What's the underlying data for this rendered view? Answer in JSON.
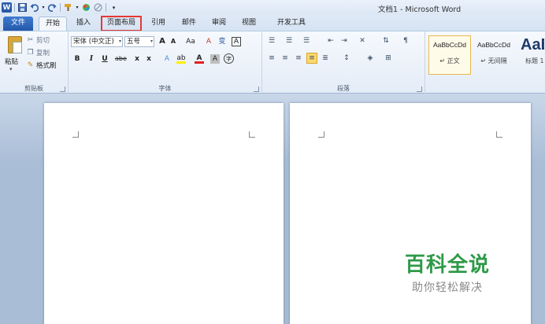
{
  "window": {
    "title": "文档1 - Microsoft Word"
  },
  "qat": {
    "icons": [
      "word-app-icon",
      "save-icon",
      "undo-icon",
      "redo-icon",
      "format-painter-icon",
      "color-icon",
      "edit-icon",
      "customize-icon"
    ],
    "word_letter": "W"
  },
  "tabs": [
    {
      "label": "文件"
    },
    {
      "label": "开始"
    },
    {
      "label": "插入"
    },
    {
      "label": "页面布局"
    },
    {
      "label": "引用"
    },
    {
      "label": "邮件"
    },
    {
      "label": "审阅"
    },
    {
      "label": "视图"
    },
    {
      "label": "开发工具"
    }
  ],
  "clipboard": {
    "paste": "粘贴",
    "cut": "剪切",
    "copy": "复制",
    "format_painter": "格式刷",
    "group_label": "剪贴板"
  },
  "font": {
    "font_name": "宋体 (中文正)",
    "font_size": "五号",
    "grow": "A",
    "shrink": "A",
    "change_case": "Aa",
    "clear_format": "A",
    "phonetic": "变",
    "border_char": "A",
    "bold": "B",
    "italic": "I",
    "underline": "U",
    "strike": "abe",
    "subscript": "x",
    "superscript": "x",
    "text_effect": "A",
    "highlight": "ab",
    "font_color": "A",
    "char_shading": "A",
    "enclose": "字",
    "group_label": "字体"
  },
  "paragraph": {
    "group_label": "段落"
  },
  "styles": {
    "items": [
      {
        "sample": "AaBbCcDd",
        "name": "↵ 正文"
      },
      {
        "sample": "AaBbCcDd",
        "name": "↵ 无间隔"
      },
      {
        "sample": "AaB",
        "name": "标题 1"
      }
    ]
  },
  "watermark": {
    "main": "百科全说",
    "sub": "助你轻松解决"
  },
  "colors": {
    "highlight_box": "#e53935",
    "watermark_green": "#2e9a48"
  }
}
